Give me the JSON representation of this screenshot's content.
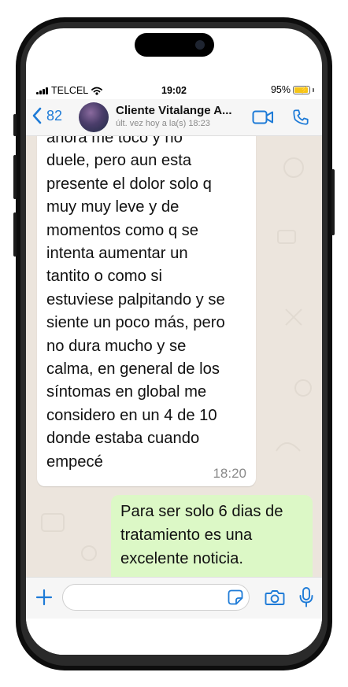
{
  "status_bar": {
    "carrier": "TELCEL",
    "time": "19:02",
    "battery": "95%",
    "battery_level": 0.95
  },
  "header": {
    "back_count": "82",
    "contact_name": "Cliente Vitalange A...",
    "last_seen": "últ. vez hoy a la(s) 18:23",
    "icons": {
      "back": "chevron-left-icon",
      "video": "video-camera-icon",
      "call": "phone-icon"
    }
  },
  "messages": {
    "incoming": {
      "lines": [
        "ahora me toco y no",
        "duele, pero aun esta",
        "presente el dolor solo q",
        "muy muy leve y de",
        "momentos como q se",
        "intenta aumentar un",
        "tantito o como si",
        "estuviese palpitando y se",
        "siente un poco más, pero",
        "no dura mucho y se",
        "calma, en general de los",
        "síntomas en global me",
        "considero en un 4 de 10",
        "donde estaba cuando",
        "empecé"
      ],
      "time": "18:20"
    },
    "outgoing": {
      "lines": [
        "Para ser solo 6 dias de",
        "tratamiento es una",
        "excelente noticia."
      ]
    }
  },
  "input_bar": {
    "message_value": "",
    "icons": {
      "attach": "plus-icon",
      "sticker": "sticker-icon",
      "camera": "camera-icon",
      "mic": "microphone-icon"
    }
  },
  "colors": {
    "accent": "#1e7bd7",
    "chat_background": "#ece5dd",
    "incoming_bubble": "#ffffff",
    "outgoing_bubble": "#dcf8c6"
  }
}
